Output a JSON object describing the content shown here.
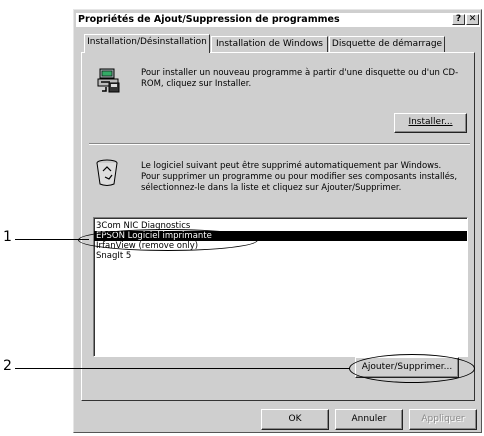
{
  "window": {
    "title": "Propriétés de Ajout/Suppression de programmes",
    "help_button": "?",
    "close_button": "✕"
  },
  "tabs": [
    {
      "label": "Installation/Désinstallation",
      "active": true
    },
    {
      "label": "Installation de Windows",
      "active": false
    },
    {
      "label": "Disquette de démarrage",
      "active": false
    }
  ],
  "install_section": {
    "icon": "install-disk-icon",
    "text": "Pour installer un nouveau programme à partir d'une disquette ou d'un CD-ROM, cliquez sur Installer.",
    "button_label": "Installer..."
  },
  "uninstall_section": {
    "icon": "recycle-bin-icon",
    "text": "Le logiciel suivant peut être supprimé automatiquement par Windows. Pour supprimer un programme ou pour modifier ses composants installés, sélectionnez-le dans la liste et cliquez sur Ajouter/Supprimer.",
    "programs": [
      {
        "label": "3Com NIC Diagnostics",
        "selected": false
      },
      {
        "label": "EPSON Logiciel imprimante",
        "selected": true
      },
      {
        "label": "IrfanView (remove only)",
        "selected": false
      },
      {
        "label": "SnagIt 5",
        "selected": false
      }
    ],
    "add_remove_label": "Ajouter/Supprimer..."
  },
  "footer": {
    "ok_label": "OK",
    "cancel_label": "Annuler",
    "apply_label": "Appliquer"
  },
  "callouts": {
    "one": "1",
    "two": "2"
  },
  "colors": {
    "dialog_bg": "#cfcfcf",
    "selection_bg": "#000000",
    "selection_fg": "#ffffff"
  }
}
